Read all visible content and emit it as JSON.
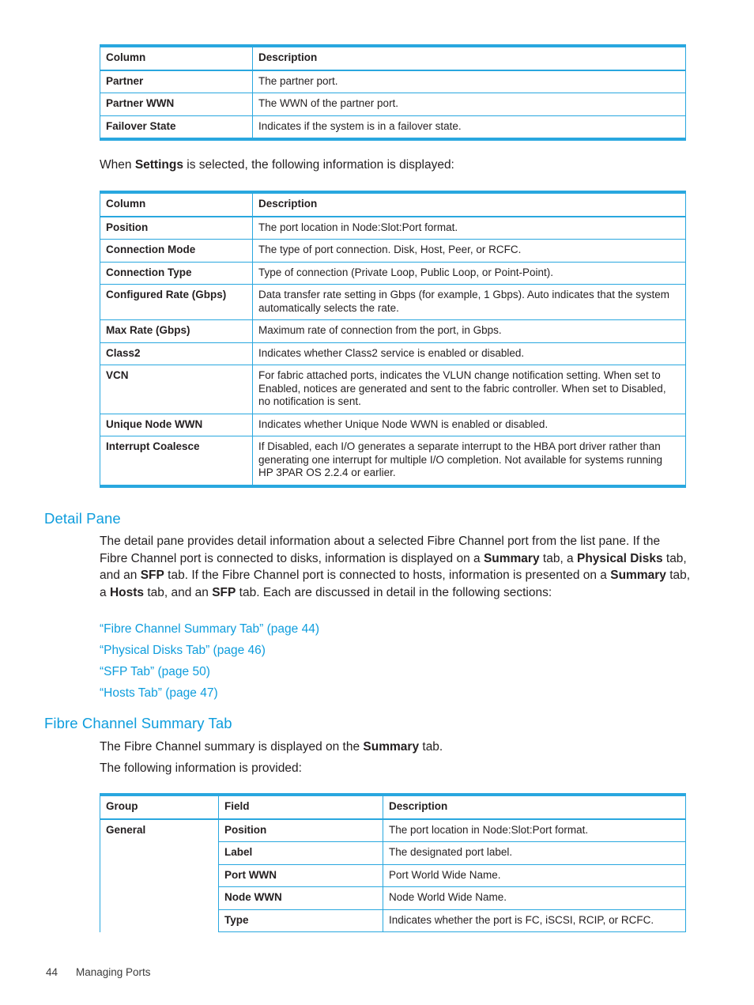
{
  "colors": {
    "accent": "#29a7df",
    "heading": "#0e9ddd",
    "link": "#0e9ddd",
    "text": "#231f20"
  },
  "partner_table": {
    "headers": [
      "Column",
      "Description"
    ],
    "rows": [
      [
        "Partner",
        "The partner port."
      ],
      [
        "Partner WWN",
        "The WWN of the partner port."
      ],
      [
        "Failover State",
        "Indicates if the system is in a failover state."
      ]
    ]
  },
  "intro": {
    "when_settings_pre": "When ",
    "when_settings_bold": "Settings",
    "when_settings_post": " is selected, the following information is displayed:"
  },
  "settings_table": {
    "headers": [
      "Column",
      "Description"
    ],
    "rows": [
      [
        "Position",
        "The port location in Node:Slot:Port format."
      ],
      [
        "Connection Mode",
        "The type of port connection. Disk, Host, Peer, or RCFC."
      ],
      [
        "Connection Type",
        "Type of connection (Private Loop, Public Loop, or Point-Point)."
      ],
      [
        "Configured Rate (Gbps)",
        "Data transfer rate setting in Gbps (for example, 1 Gbps). Auto indicates that the system automatically selects the rate."
      ],
      [
        "Max Rate (Gbps)",
        "Maximum rate of connection from the port, in Gbps."
      ],
      [
        "Class2",
        "Indicates whether Class2 service is enabled or disabled."
      ],
      [
        "VCN",
        "For fabric attached ports, indicates the VLUN change notification setting. When set to Enabled, notices are generated and sent to the fabric controller. When set to Disabled, no notification is sent."
      ],
      [
        "Unique Node WWN",
        "Indicates whether Unique Node WWN is enabled or disabled."
      ],
      [
        "Interrupt Coalesce",
        "If Disabled, each I/O generates a separate interrupt to the HBA port driver rather than generating one interrupt for multiple I/O completion. Not available for systems running HP 3PAR OS 2.2.4 or earlier."
      ]
    ]
  },
  "detail_pane": {
    "heading": "Detail Pane",
    "paragraph": {
      "s1": "The detail pane provides detail information about a selected Fibre Channel port from the list pane. If the Fibre Channel port is connected to disks, information is displayed on a ",
      "b1": "Summary",
      "s2": " tab, a ",
      "b2": "Physical Disks",
      "s3": " tab, and an ",
      "b3": "SFP",
      "s4": " tab. If the Fibre Channel port is connected to hosts, information is presented on a ",
      "b4": "Summary",
      "s5": " tab, a ",
      "b5": "Hosts",
      "s6": " tab, and an ",
      "b6": "SFP",
      "s7": " tab. Each are discussed in detail in the following sections:"
    },
    "links": [
      "“Fibre Channel Summary Tab” (page 44)",
      "“Physical Disks Tab” (page 46)",
      "“SFP Tab” (page 50)",
      "“Hosts Tab” (page 47)"
    ]
  },
  "fc_summary": {
    "heading": "Fibre Channel Summary Tab",
    "line1_pre": "The Fibre Channel summary is displayed on the ",
    "line1_bold": "Summary",
    "line1_post": " tab.",
    "line2": "The following information is provided:"
  },
  "summary_table": {
    "headers": [
      "Group",
      "Field",
      "Description"
    ],
    "group": "General",
    "rows": [
      [
        "Position",
        "The port location in Node:Slot:Port format."
      ],
      [
        "Label",
        "The designated port label."
      ],
      [
        "Port WWN",
        "Port World Wide Name."
      ],
      [
        "Node WWN",
        "Node World Wide Name."
      ],
      [
        "Type",
        "Indicates whether the port is FC, iSCSI, RCIP, or RCFC."
      ]
    ]
  },
  "footer": {
    "page_number": "44",
    "chapter": "Managing Ports"
  }
}
